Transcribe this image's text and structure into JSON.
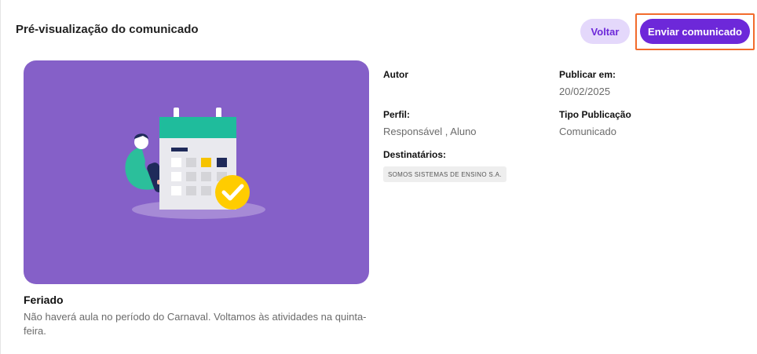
{
  "header": {
    "title": "Pré-visualização do comunicado",
    "back_label": "Voltar",
    "send_label": "Enviar comunicado"
  },
  "illustration": {
    "icon": "calendar-check-illustration",
    "colors": {
      "background": "#8560c8",
      "calendar_header": "#1fbc9c",
      "check_badge": "#ffcc00"
    }
  },
  "post": {
    "title": "Feriado",
    "body": "Não haverá aula no período do Carnaval. Voltamos às atividades na quinta-feira."
  },
  "details": {
    "author_label": "Autor",
    "publish_label": "Publicar em:",
    "publish_value": "20/02/2025",
    "profile_label": "Perfil:",
    "profile_value": "Responsável , Aluno",
    "type_label": "Tipo Publicação",
    "type_value": "Comunicado",
    "recipients_label": "Destinatários:",
    "recipients": [
      "SOMOS SISTEMAS DE ENSINO S.A."
    ]
  },
  "colors": {
    "accent": "#6d28d9",
    "accent_light": "#e4d8fb",
    "highlight": "#f26b2c"
  }
}
